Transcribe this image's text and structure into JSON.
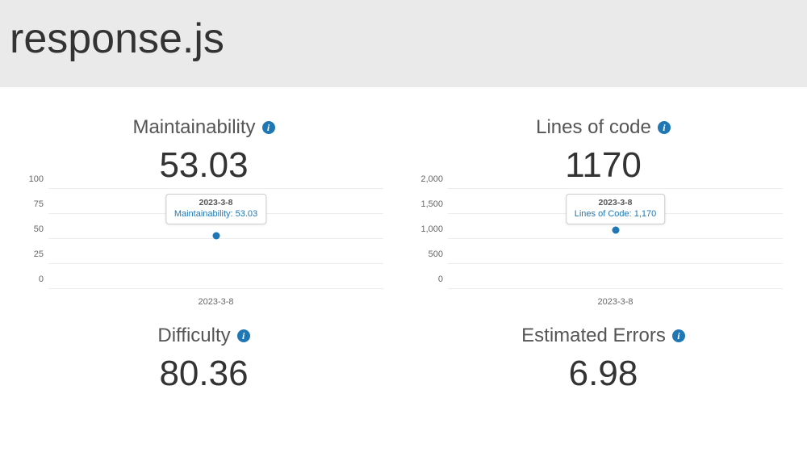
{
  "header": {
    "title": "response.js"
  },
  "metrics": {
    "maintainability": {
      "label": "Maintainability",
      "value": "53.03"
    },
    "loc": {
      "label": "Lines of code",
      "value": "1170"
    },
    "difficulty": {
      "label": "Difficulty",
      "value": "80.36"
    },
    "errors": {
      "label": "Estimated Errors",
      "value": "6.98"
    }
  },
  "chart_data": [
    {
      "id": "maintainability",
      "type": "scatter",
      "categories": [
        "2023-3-8"
      ],
      "values": [
        53.03
      ],
      "ylim": [
        0,
        100
      ],
      "yticks": [
        0,
        25,
        50,
        75,
        100
      ],
      "tooltip": {
        "date": "2023-3-8",
        "series": "Maintainability",
        "value_str": "53.03"
      }
    },
    {
      "id": "loc",
      "type": "scatter",
      "categories": [
        "2023-3-8"
      ],
      "values": [
        1170
      ],
      "ylim": [
        0,
        2000
      ],
      "yticks": [
        0,
        500,
        1000,
        1500,
        2000
      ],
      "ytick_labels": [
        "0",
        "500",
        "1,000",
        "1,500",
        "2,000"
      ],
      "tooltip": {
        "date": "2023-3-8",
        "series": "Lines of Code",
        "value_str": "1,170"
      }
    }
  ]
}
